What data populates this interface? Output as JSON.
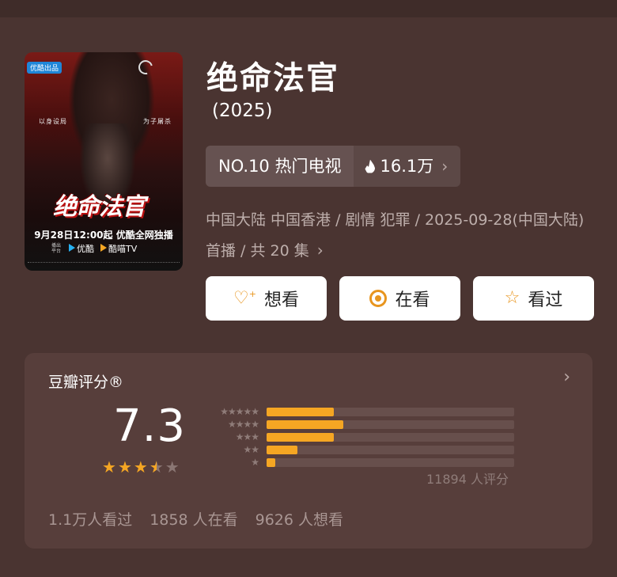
{
  "poster": {
    "badge": "优酷出品",
    "title": "绝命法官",
    "tagline_left": "以身设局",
    "tagline_right": "为子屠杀",
    "date_line": "9月28日12:00起 优酷全网独播",
    "platform_prefix": "播出平台",
    "platform1": "优酷",
    "platform2": "酷喵TV"
  },
  "title": "绝命法官",
  "year": "(2025)",
  "rank": {
    "label": "NO.10 热门电视",
    "heat": "16.1万"
  },
  "meta": "中国大陆 中国香港 / 剧情 犯罪 / 2025-09-28(中国大陆) 首播 / 共 20 集",
  "actions": [
    {
      "label": "想看",
      "icon": "heart-plus-icon"
    },
    {
      "label": "在看",
      "icon": "target-icon"
    },
    {
      "label": "看过",
      "icon": "star-icon"
    }
  ],
  "rating": {
    "header": "豆瓣评分®",
    "score": "7.3",
    "stars_value": 3.5,
    "distribution": [
      {
        "label": "★★★★★",
        "fraction": 0.27
      },
      {
        "label": "★★★★",
        "fraction": 0.31
      },
      {
        "label": "★★★",
        "fraction": 0.27
      },
      {
        "label": "★★",
        "fraction": 0.125
      },
      {
        "label": "★",
        "fraction": 0.035
      }
    ],
    "count": "11894 人评分",
    "stats": [
      "1.1万人看过",
      "1858 人在看",
      "9626 人想看"
    ]
  },
  "colors": {
    "accent": "#f5a623",
    "background": "#4a3431",
    "card": "#573e3b"
  }
}
